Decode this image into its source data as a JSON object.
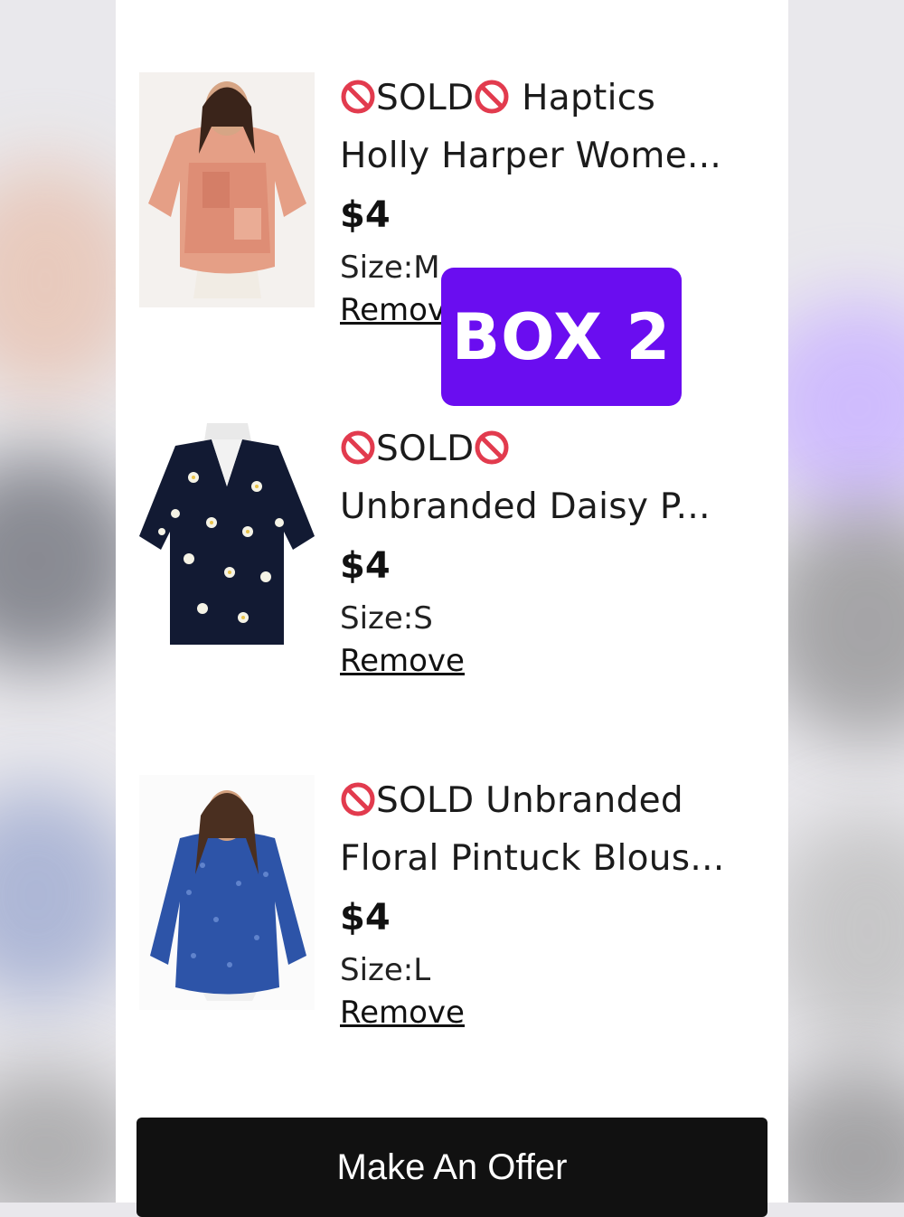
{
  "cart": {
    "items": [
      {
        "title_line1": "SOLD",
        "title_after_icons": " Haptics",
        "title_line2": "Holly Harper Wome...",
        "price": "$4",
        "size_label": "Size:",
        "size_value": "M",
        "remove_label": "Remove",
        "image": "orange-patchwork-top"
      },
      {
        "title_line1": "SOLD",
        "title_after_icons": "",
        "title_line2": "Unbranded Daisy P...",
        "price": "$4",
        "size_label": "Size:",
        "size_value": "S",
        "remove_label": "Remove",
        "image": "navy-daisy-blouse"
      },
      {
        "title_line1": "SOLD Unbranded",
        "title_after_icons": "",
        "title_line2": "Floral Pintuck Blous...",
        "price": "$4",
        "size_label": "Size:",
        "size_value": "L",
        "remove_label": "Remove",
        "image": "blue-floral-blouse"
      }
    ]
  },
  "overlay": {
    "badge_text": "BOX 2",
    "badge_color": "#6a0df0"
  },
  "actions": {
    "make_offer_label": "Make An Offer"
  },
  "icons": {
    "sold": "prohibited-icon"
  }
}
